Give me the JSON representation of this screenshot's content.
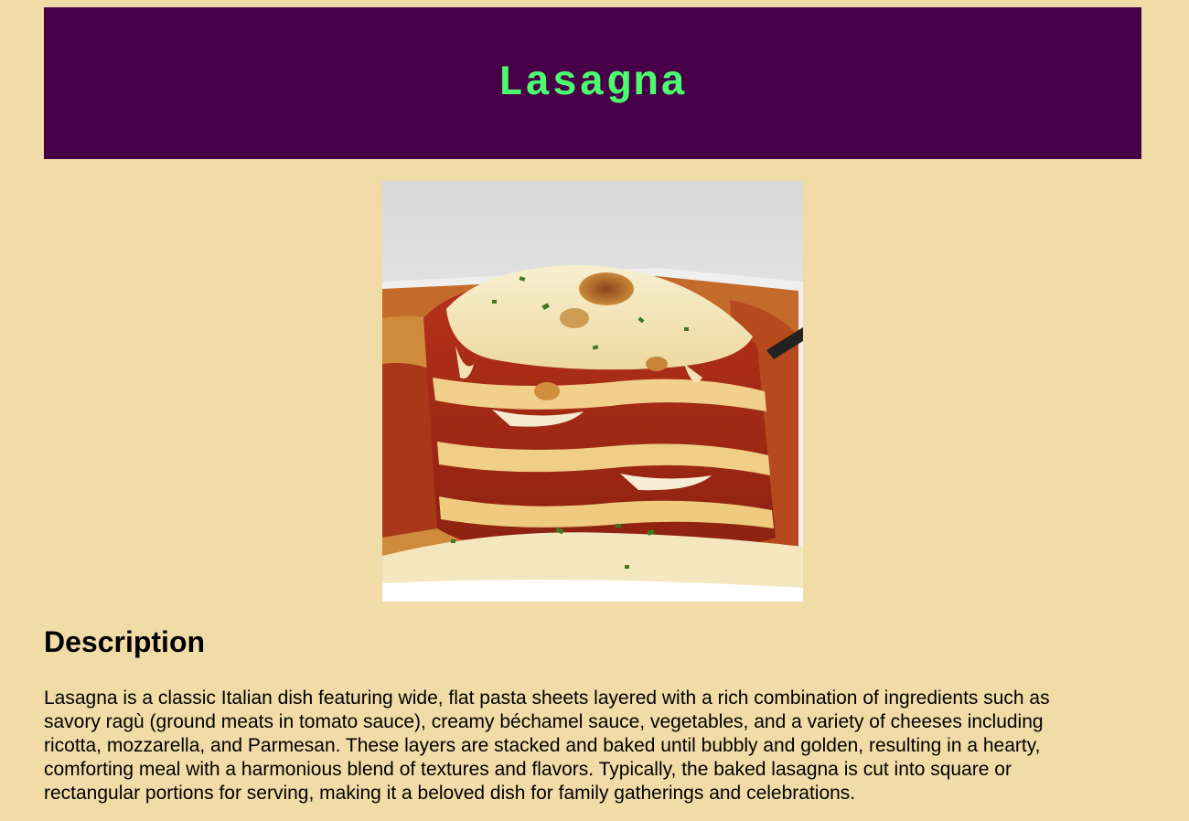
{
  "page": {
    "title": "Lasagna",
    "image_alt": "Lasagna"
  },
  "description": {
    "heading": "Description",
    "text": "Lasagna is a classic Italian dish featuring wide, flat pasta sheets layered with a rich combination of ingredients such as savory ragù (ground meats in tomato sauce), creamy béchamel sauce, vegetables, and a variety of cheeses including ricotta, mozzarella, and Parmesan. These layers are stacked and baked until bubbly and golden, resulting in a hearty, comforting meal with a harmonious blend of textures and flavors. Typically, the baked lasagna is cut into square or rectangular portions for serving, making it a beloved dish for family gatherings and celebrations."
  },
  "colors": {
    "background": "#f1dca7",
    "header_background": "#470047",
    "title_color": "#4cfc6f"
  }
}
